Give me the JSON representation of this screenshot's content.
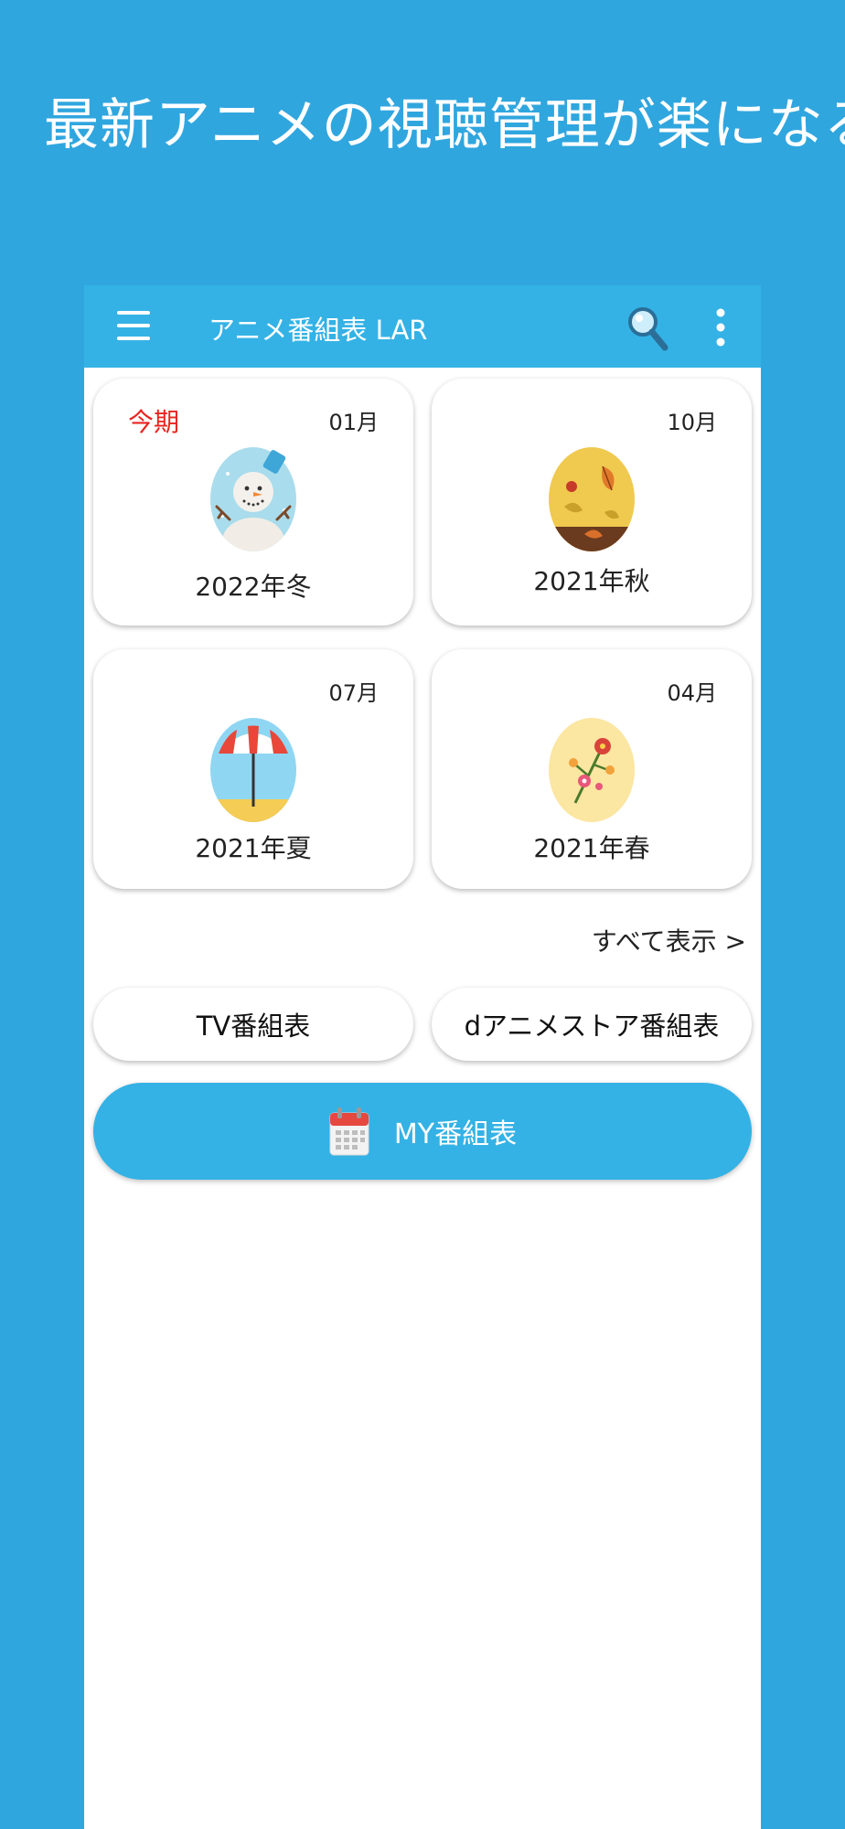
{
  "headline": "最新アニメの視聴管理が楽になる",
  "appbar": {
    "title": "アニメ番組表 LAR",
    "menu_icon": "hamburger-menu-icon",
    "search_icon": "search-icon",
    "more_icon": "more-vertical-icon"
  },
  "seasons": [
    {
      "badge": "今期",
      "month": "01月",
      "label": "2022年冬",
      "icon": "snowman-icon"
    },
    {
      "badge": "",
      "month": "10月",
      "label": "2021年秋",
      "icon": "autumn-leaves-icon"
    },
    {
      "badge": "",
      "month": "07月",
      "label": "2021年夏",
      "icon": "beach-umbrella-icon"
    },
    {
      "badge": "",
      "month": "04月",
      "label": "2021年春",
      "icon": "spring-flowers-icon"
    }
  ],
  "see_all": "すべて表示 >",
  "buttons": {
    "tv": "TV番組表",
    "danime": "dアニメストア番組表",
    "my": "MY番組表"
  },
  "colors": {
    "background": "#30a6df",
    "accent": "#34b2e5",
    "current_badge": "#e8241f"
  }
}
